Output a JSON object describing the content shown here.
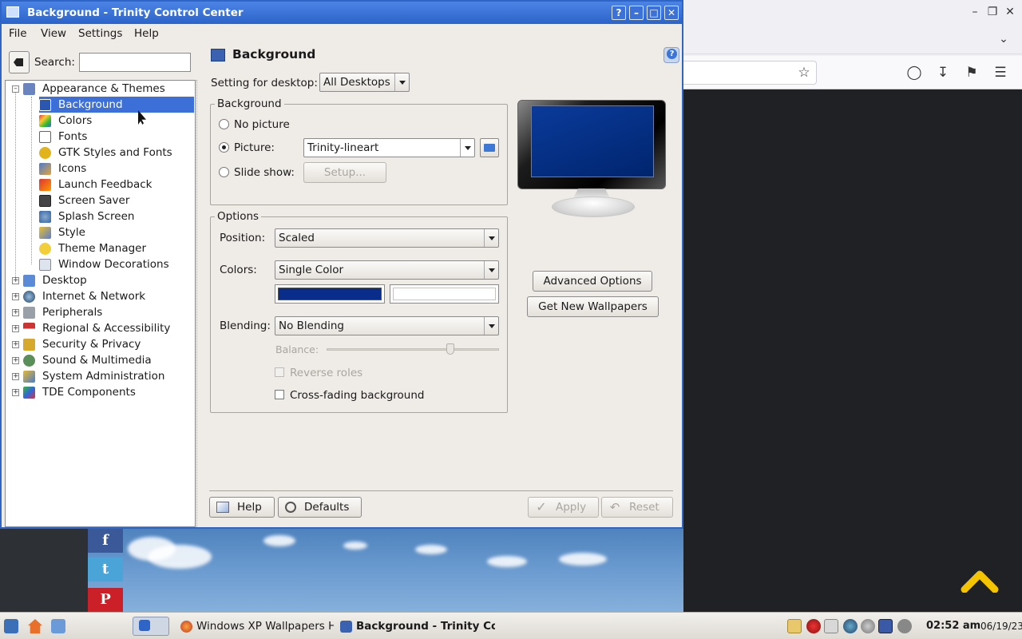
{
  "dialog": {
    "title": "Background - Trinity Control Center",
    "menus": [
      "File",
      "View",
      "Settings",
      "Help"
    ],
    "search_label": "Search:",
    "search_placeholder": "",
    "tree": {
      "category": "Appearance & Themes",
      "children": [
        "Background",
        "Colors",
        "Fonts",
        "GTK Styles and Fonts",
        "Icons",
        "Launch Feedback",
        "Screen Saver",
        "Splash Screen",
        "Style",
        "Theme Manager",
        "Window Decorations"
      ],
      "collapsed": [
        "Desktop",
        "Internet & Network",
        "Peripherals",
        "Regional & Accessibility",
        "Security & Privacy",
        "Sound & Multimedia",
        "System Administration",
        "TDE Components"
      ],
      "selected": "Background"
    },
    "page": {
      "title": "Background",
      "desktop_label": "Setting for desktop:",
      "desktop_value": "All Desktops",
      "background_group": "Background",
      "no_picture": "No picture",
      "picture": "Picture:",
      "picture_value": "Trinity-lineart",
      "slide_show": "Slide show:",
      "setup_button": "Setup...",
      "options_group": "Options",
      "position_label": "Position:",
      "position_value": "Scaled",
      "colors_label": "Colors:",
      "colors_value": "Single Color",
      "color1": "#0a2d8c",
      "color2": "#ffffff",
      "blending_label": "Blending:",
      "blending_value": "No Blending",
      "balance_label": "Balance:",
      "balance_level": 0.73,
      "reverse_roles": "Reverse roles",
      "cross_fading": "Cross-fading background",
      "advanced_options": "Advanced Options",
      "get_new_wallpapers": "Get New Wallpapers"
    },
    "buttons": {
      "help": "Help",
      "defaults": "Defaults",
      "apply": "Apply",
      "reset": "Reset"
    }
  },
  "browser": {
    "toolbar_icons": [
      "star-icon",
      "pocket-icon",
      "download-icon",
      "extensions-icon",
      "menu-icon"
    ]
  },
  "social": [
    "f",
    "t",
    "P"
  ],
  "taskbar": {
    "tasks": [
      "Windows XP Wallpapers H",
      "Background - Trinity Co"
    ],
    "time": "02:52 am",
    "date": "06/19/23"
  },
  "colors": {
    "titlebar": "#2f65c6",
    "selection": "#3d6fd8",
    "accent_yellow": "#f5c400"
  }
}
